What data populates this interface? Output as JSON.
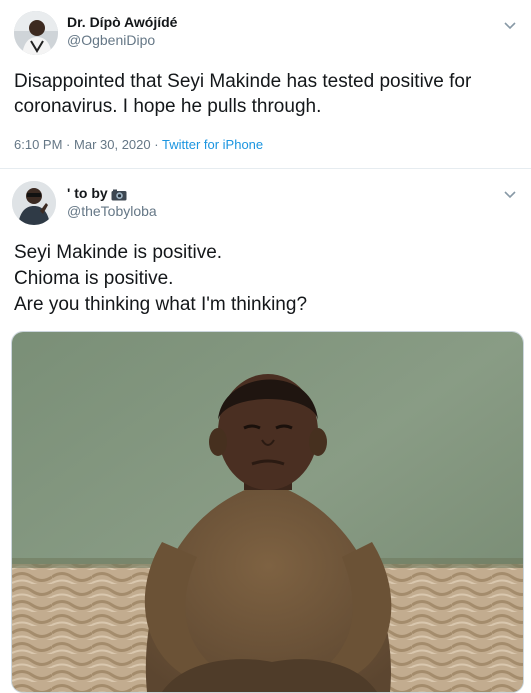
{
  "tweets": [
    {
      "display_name": "Dr. Dípò Awójídé",
      "handle": "@OgbeniDipo",
      "text": "Disappointed that Seyi Makinde has tested positive for coronavirus. I hope he pulls through.",
      "time": "6:10 PM",
      "sep1": "·",
      "date": "Mar 30, 2020",
      "sep2": "·",
      "source": "Twitter for iPhone"
    },
    {
      "display_name": "' to by",
      "handle": "@theTobyloba",
      "lines": [
        "Seyi Makinde is positive.",
        "Chioma is positive.",
        "Are you thinking what I'm thinking?"
      ]
    }
  ],
  "colors": {
    "text": "#14171a",
    "secondary": "#657786",
    "link": "#1b95e0",
    "divider": "#e6ecf0"
  },
  "icons": [
    "chevron-down-icon",
    "camera-emoji-icon"
  ]
}
